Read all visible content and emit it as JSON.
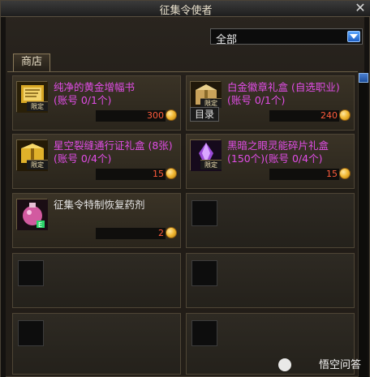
{
  "window": {
    "title": "征集令使者"
  },
  "filter": {
    "value": "全部"
  },
  "tab": {
    "label": "商店"
  },
  "items": [
    {
      "name": "纯净的黄金增幅书\n(账号 0/1个)",
      "price": "300",
      "badge": "限定",
      "color": "purple",
      "icon": "scroll-icon"
    },
    {
      "name": "白金徽章礼盒 (自选职业)(账号 0/1个)",
      "price": "240",
      "badge": "限定",
      "color": "purple",
      "icon": "badge-box-icon",
      "extra": "目录"
    },
    {
      "name": "星空裂缝通行证礼盒 (8张)(账号 0/4个)",
      "price": "15",
      "badge": "限定",
      "color": "purple",
      "icon": "pass-box-icon"
    },
    {
      "name": "黑暗之眼灵能碎片礼盒 (150个)(账号 0/4个)",
      "price": "15",
      "badge": "限定",
      "color": "purple",
      "icon": "crystal-box-icon"
    },
    {
      "name": "征集令特制恢复药剂",
      "price": "2",
      "badge": "",
      "color": "white",
      "icon": "potion-icon"
    }
  ],
  "watermark": {
    "text": "悟空问答"
  },
  "colors": {
    "purple": "#e14de6",
    "price": "#ff5c3c",
    "accent": "#1e5fc4"
  }
}
